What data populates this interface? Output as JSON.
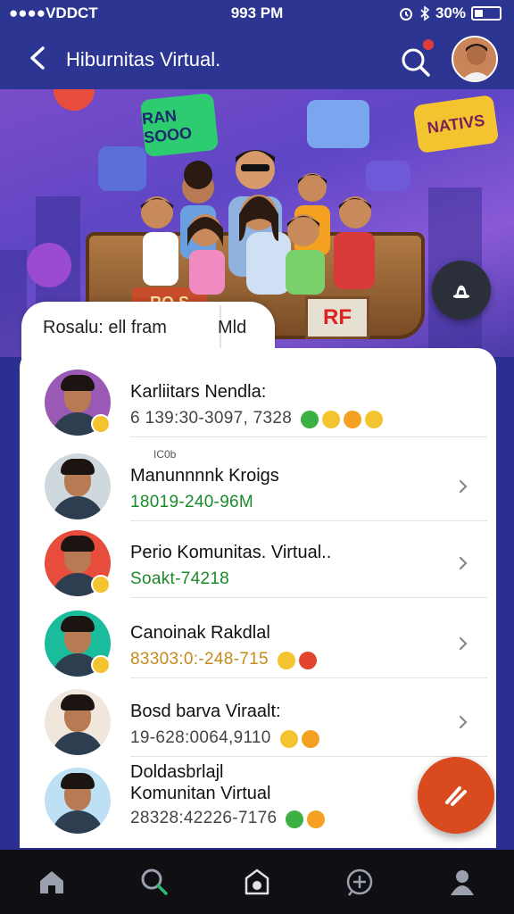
{
  "status_bar": {
    "carrier": "●●●●VDDCT",
    "time": "993 PM",
    "battery": "30%"
  },
  "header": {
    "title": "Hiburnitas Virtual."
  },
  "banner": {
    "sign_left": "RAN SOOO",
    "sign_right": "NATIVS",
    "kiosk_sign": "RF",
    "kiosk_sign_left": "RO S"
  },
  "tabs": {
    "tab1": "Rosalu: ell fram",
    "tab2": "Mld"
  },
  "list": [
    {
      "name": "Karliitars Nendla:",
      "sub": "6 139:30-3097, 7328",
      "sub_color": "#444444",
      "overline": "",
      "chevron": false,
      "emojis": [
        "#3cb043",
        "#f4c430",
        "#f4a020",
        "#f4c430"
      ],
      "avatar_bg": "#9b59b6",
      "badge": true
    },
    {
      "name": "Manunnnnk Kroigs",
      "sub": "18019-240-96M",
      "sub_color": "#1a8a2a",
      "overline": "IC0b",
      "chevron": true,
      "emojis": [],
      "avatar_bg": "#cfd8dc",
      "badge": false
    },
    {
      "name": "Perio Komunitas. Virtual..",
      "sub": "Soakt-74218",
      "sub_color": "#1a8a2a",
      "overline": "",
      "chevron": true,
      "emojis": [],
      "avatar_bg": "#e74c3c",
      "badge": true
    },
    {
      "name": "Canoinak Rakdlal",
      "sub": "83303:0:-248-715",
      "sub_color": "#c58b1a",
      "overline": "",
      "chevron": true,
      "emojis": [
        "#f4c430",
        "#e2452d"
      ],
      "avatar_bg": "#1abc9c",
      "badge": true
    },
    {
      "name": "Bosd barva Viraalt:",
      "sub": "19-628:0064,9110",
      "sub_color": "#444444",
      "overline": "",
      "chevron": true,
      "emojis": [
        "#f4c430",
        "#f4a020"
      ],
      "avatar_bg": "#f0e6dc",
      "badge": false
    },
    {
      "name": "Doldasbrlajl",
      "name2": "Komunitan Virtual",
      "sub": "28328:42226-7176",
      "sub_color": "#444444",
      "overline": "",
      "chevron": false,
      "emojis": [
        "#3cb043",
        "#f4a020"
      ],
      "avatar_bg": "#bde0f5",
      "badge": false
    }
  ],
  "nav": [
    "home-icon",
    "search-icon",
    "feed-icon",
    "add-icon",
    "profile-icon"
  ]
}
